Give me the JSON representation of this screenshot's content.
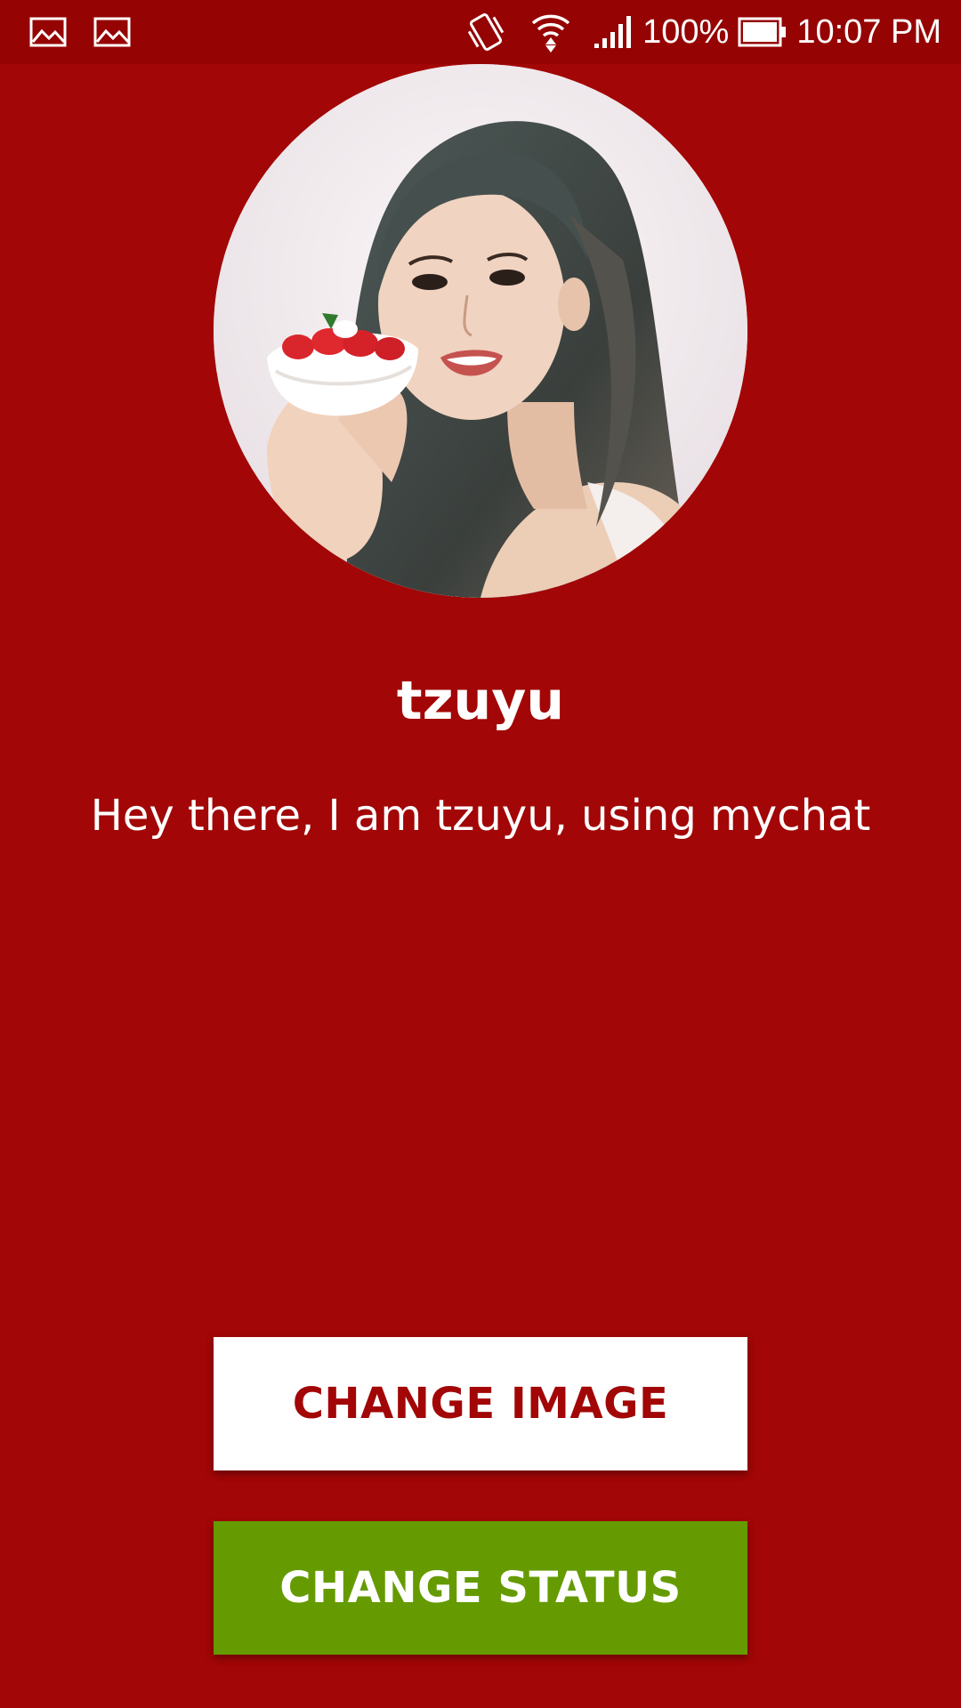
{
  "status_bar": {
    "notification_icons": [
      "image-notification-icon",
      "image-notification-icon"
    ],
    "battery_percent": "100%",
    "time": "10:07 PM",
    "icons": [
      "vibrate-icon",
      "wifi-icon",
      "signal-icon",
      "battery-icon"
    ]
  },
  "profile": {
    "avatar_alt": "profile photo",
    "name": "tzuyu",
    "status": "Hey there, I am tzuyu, using mychat"
  },
  "buttons": {
    "change_image": "CHANGE IMAGE",
    "change_status": "CHANGE STATUS"
  },
  "colors": {
    "background": "#a20606",
    "status_bar": "#960303",
    "change_image_bg": "#ffffff",
    "change_status_bg": "#659b00"
  }
}
